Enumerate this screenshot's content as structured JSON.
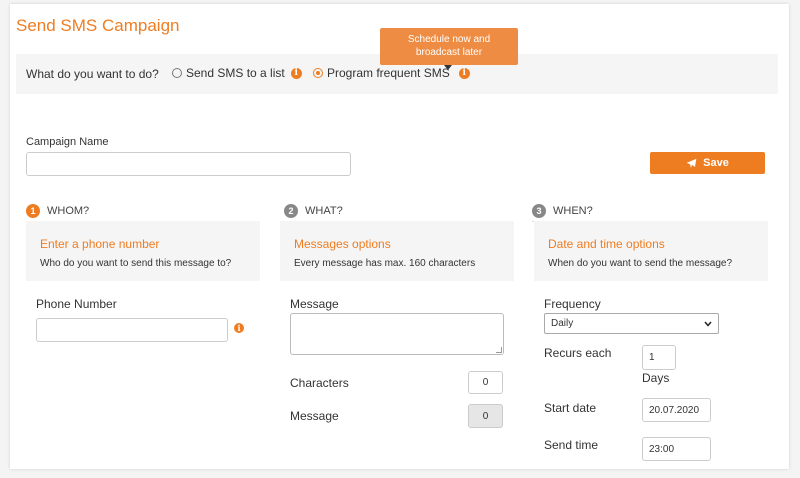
{
  "page": {
    "title": "Send SMS Campaign"
  },
  "question": {
    "text": "What do you want to do?",
    "options": [
      {
        "label": "Send SMS to a list",
        "selected": false
      },
      {
        "label": "Program frequent SMS",
        "selected": true
      }
    ],
    "tooltip": "Schedule now and broadcast later"
  },
  "campaign": {
    "name_label": "Campaign Name",
    "name_value": "",
    "save_label": "Save"
  },
  "steps": [
    {
      "number": "1",
      "title": "WHOM?",
      "heading": "Enter a phone number",
      "description": "Who do you want to send this message to?"
    },
    {
      "number": "2",
      "title": "WHAT?",
      "heading": "Messages options",
      "description": "Every message has max. 160 characters"
    },
    {
      "number": "3",
      "title": "WHEN?",
      "heading": "Date and time options",
      "description": "When do you want to send the message?"
    }
  ],
  "whom": {
    "phone_label": "Phone Number",
    "phone_value": ""
  },
  "what": {
    "message_label": "Message",
    "characters_label": "Characters",
    "characters_value": "0",
    "message_count_label": "Message",
    "message_count_value": "0"
  },
  "when": {
    "frequency_label": "Frequency",
    "frequency_value": "Daily",
    "recurs_label": "Recurs each",
    "recurs_value": "1",
    "recurs_unit": "Days",
    "start_label": "Start date",
    "start_value": "20.07.2020",
    "time_label": "Send time",
    "time_value": "23:00"
  },
  "colors": {
    "accent": "#ee7d22",
    "panel": "#f5f5f5",
    "step_inactive": "#888888"
  },
  "icons": {
    "info": "info-circle-icon",
    "save": "paper-plane-icon",
    "select": "chevron-down-icon"
  }
}
